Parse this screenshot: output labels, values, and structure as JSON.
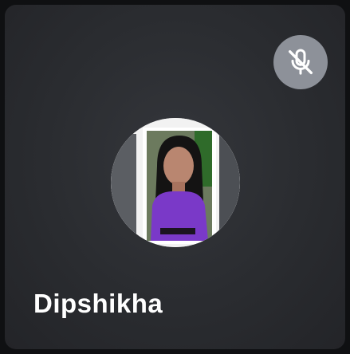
{
  "participant": {
    "name": "Dipshikha",
    "avatar_icon": "profile-photo",
    "mic_status_icon": "microphone-off-icon"
  },
  "colors": {
    "tile_background": "#2a2c30",
    "mute_badge": "#8d9199",
    "name_text": "#ffffff"
  }
}
